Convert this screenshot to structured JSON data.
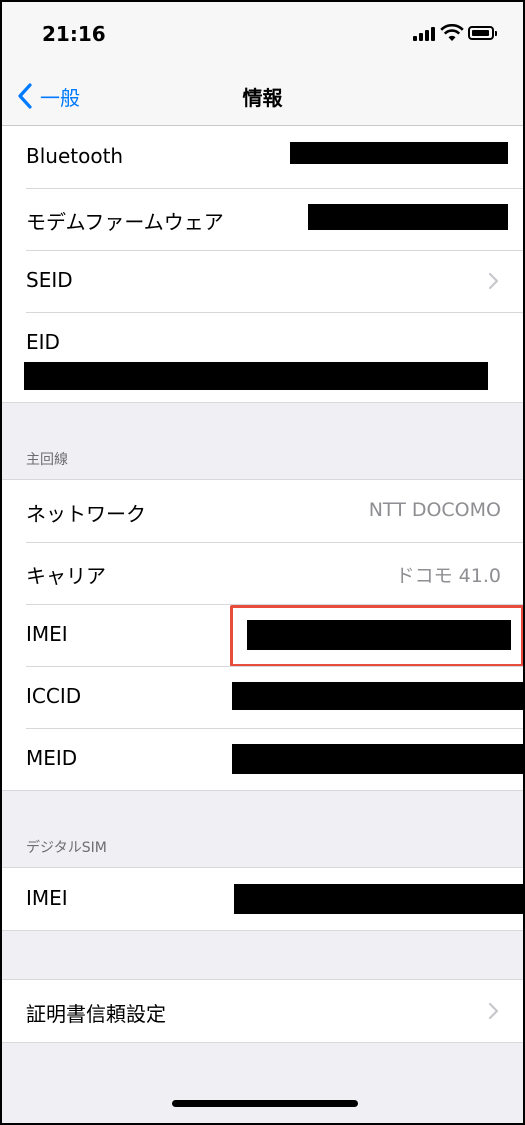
{
  "status_bar": {
    "time": "21:16"
  },
  "nav": {
    "back_label": "一般",
    "title": "情報"
  },
  "top_group": {
    "bluetooth": "Bluetooth",
    "modem_firmware": "モデムファームウェア",
    "seid": "SEID",
    "eid": "EID"
  },
  "primary_line": {
    "header": "主回線",
    "network_label": "ネットワーク",
    "network_value": "NTT DOCOMO",
    "carrier_label": "キャリア",
    "carrier_value": "ドコモ 41.0",
    "imei_label": "IMEI",
    "iccid_label": "ICCID",
    "meid_label": "MEID"
  },
  "digital_sim": {
    "header": "デジタルSIM",
    "imei_label": "IMEI"
  },
  "cert_trust": {
    "label": "証明書信頼設定"
  },
  "colors": {
    "accent": "#007aff",
    "highlight": "#e74c3c",
    "redaction": "#000000"
  }
}
